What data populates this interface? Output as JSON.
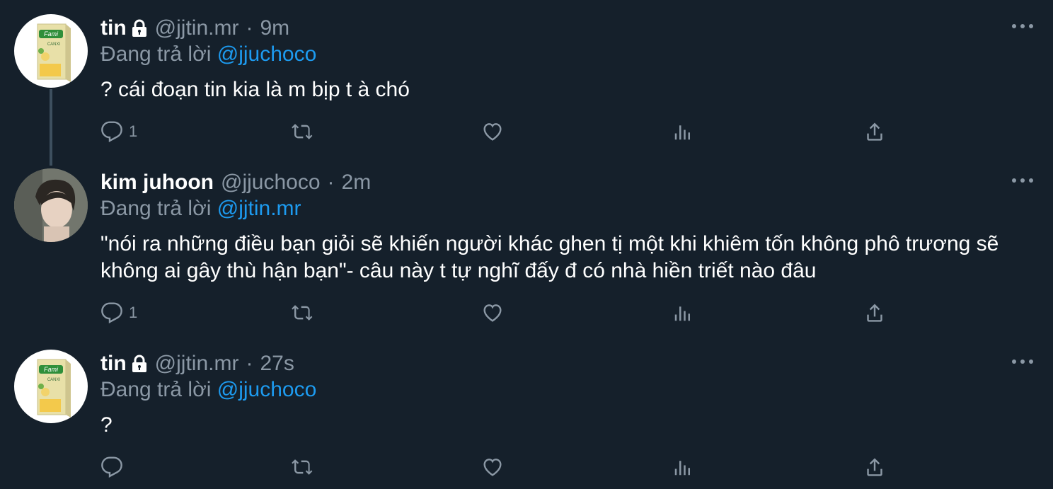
{
  "tweets": [
    {
      "name": "tin",
      "locked": true,
      "handle": "@jjtin.mr",
      "separator": "·",
      "time": "9m",
      "reply_prefix": "Đang trả lời",
      "reply_to": "@jjuchoco",
      "text": "? cái đoạn tin kia là m bịp t à chó",
      "reply_count": "1",
      "avatar_icon": "fami-milk-carton-avatar"
    },
    {
      "name": "kim juhoon",
      "locked": false,
      "handle": "@jjuchoco",
      "separator": "·",
      "time": "2m",
      "reply_prefix": "Đang trả lời",
      "reply_to": "@jjtin.mr",
      "text": "\"nói ra những điều bạn giỏi sẽ khiến người khác ghen tị một khi khiêm tốn không phô trương sẽ không ai gây thù hận bạn\"- câu này t tự nghĩ đấy đ có nhà hiền triết nào đâu",
      "reply_count": "1",
      "avatar_icon": "person-photo-avatar"
    },
    {
      "name": "tin",
      "locked": true,
      "handle": "@jjtin.mr",
      "separator": "·",
      "time": "27s",
      "reply_prefix": "Đang trả lời",
      "reply_to": "@jjuchoco",
      "text": "?",
      "reply_count": "",
      "avatar_icon": "fami-milk-carton-avatar"
    }
  ],
  "fami_label": "Fami",
  "fami_sub": "CANXI",
  "colors": {
    "background": "#15202b",
    "secondary_text": "#8b98a5",
    "link": "#1d9bf0",
    "thread_line": "#3d4f5e"
  }
}
